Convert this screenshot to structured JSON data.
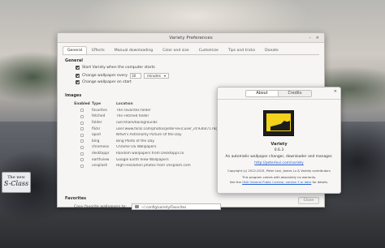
{
  "wallpaper": {
    "plate_line1": "The new",
    "plate_line2": "S-Class"
  },
  "prefs": {
    "title": "Variety Preferences",
    "window_buttons": [
      "–",
      "✕"
    ],
    "tabs": [
      {
        "label": "General"
      },
      {
        "label": "Effects"
      },
      {
        "label": "Manual downloading"
      },
      {
        "label": "Color and size"
      },
      {
        "label": "Customize"
      },
      {
        "label": "Tips and tricks"
      },
      {
        "label": "Donate"
      }
    ],
    "general": {
      "heading": "General",
      "start_label": "Start Variety when the computer starts",
      "change_every_label": "Change wallpaper every",
      "change_every_value": "30",
      "change_every_unit": "minutes",
      "change_on_start_label": "Change wallpaper on start"
    },
    "images": {
      "heading": "Images",
      "col_enabled": "Enabled",
      "col_type": "Type",
      "col_location": "Location",
      "rows": [
        {
          "type": "favorites",
          "location": "The Favorites folder"
        },
        {
          "type": "fetched",
          "location": "The Fetched folder"
        },
        {
          "type": "folder",
          "location": "/usr/share/backgrounds"
        },
        {
          "type": "flickr",
          "location": "user:www.flickr.com/photos/peter-levi/;user_id:93647178@N00;"
        },
        {
          "type": "apod",
          "location": "NASA's Astronomy Picture Of the Day"
        },
        {
          "type": "bing",
          "location": "Bing Photo of the Day"
        },
        {
          "type": "chromeos",
          "location": "Chrome OS Wallpapers"
        },
        {
          "type": "desktoppr",
          "location": "Random wallpapers from Desktoppr.co"
        },
        {
          "type": "earthview",
          "location": "Google Earth View Wallpapers"
        },
        {
          "type": "unsplash",
          "location": "High-resolution photos from Unsplash.com"
        }
      ]
    },
    "favorites": {
      "heading": "Favorites",
      "copy_label": "Copy favorite wallpapers to:",
      "path": "~/.config/variety/Favorites"
    },
    "close_label": "Close"
  },
  "about": {
    "close_glyph": "✕",
    "tab_about": "About",
    "tab_credits": "Credits",
    "name": "Variety",
    "version": "0.6.3",
    "description": "An automatic wallpaper changer, downloader and manager.",
    "link": "http://peterlevi.com/variety",
    "copyright": "Copyright (c) 2012-2015, Peter Levi, James Lu & Variety contributors",
    "warranty": "This program comes with absolutely no warranty.",
    "gpl_pre": "See the",
    "gpl_link": "GNU General Public License, version 3 or later",
    "gpl_post": "for details.",
    "logo_colors": {
      "screen": "#f2d21b",
      "frame": "#1d1d1d"
    }
  }
}
